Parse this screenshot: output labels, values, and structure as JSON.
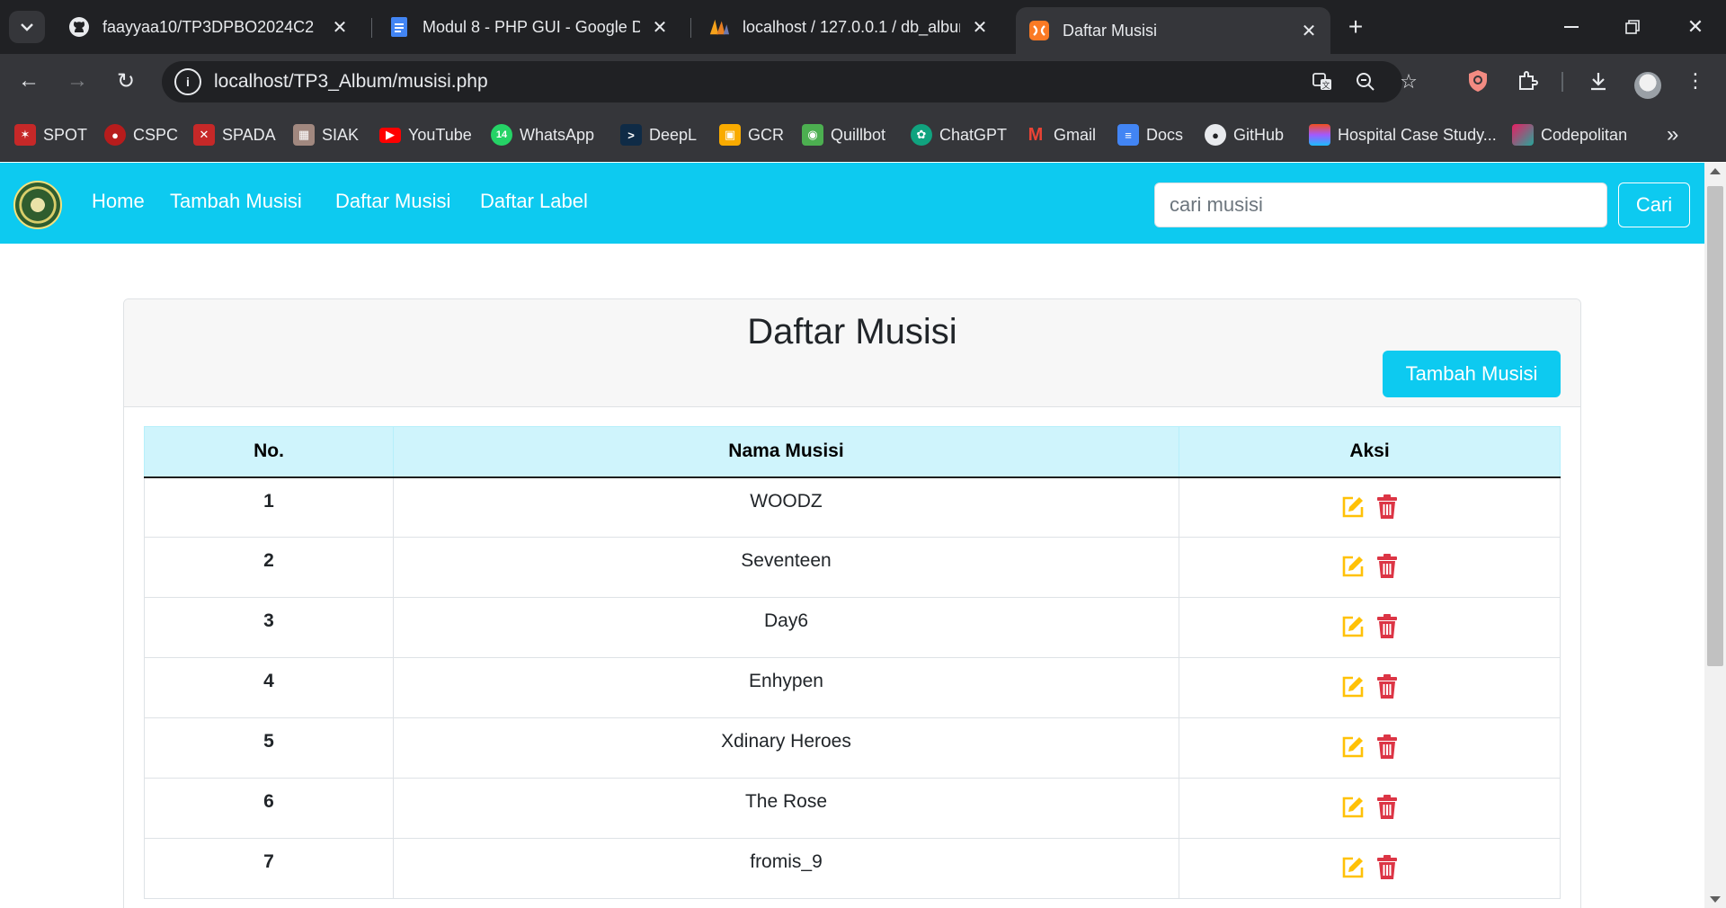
{
  "browser": {
    "tabs": [
      {
        "title": "faayyaa10/TP3DPBO2024C2",
        "icon": "github-icon"
      },
      {
        "title": "Modul 8 - PHP GUI - Google Do",
        "icon": "google-docs-icon"
      },
      {
        "title": "localhost / 127.0.0.1 / db_album",
        "icon": "phpmyadmin-icon"
      },
      {
        "title": "Daftar Musisi",
        "icon": "xampp-icon"
      }
    ],
    "url": "localhost/TP3_Album/musisi.php",
    "bookmarks": [
      {
        "label": "SPOT",
        "color": "#c62828"
      },
      {
        "label": "CSPC",
        "color": "#b71c1c"
      },
      {
        "label": "SPADA",
        "color": "#c62828"
      },
      {
        "label": "SIAK",
        "color": "#a1887f"
      },
      {
        "label": "YouTube",
        "color": "#ff0000"
      },
      {
        "label": "WhatsApp",
        "color": "#25d366"
      },
      {
        "label": "DeepL",
        "color": "#0f2b46"
      },
      {
        "label": "GCR",
        "color": "#f9ab00"
      },
      {
        "label": "Quillbot",
        "color": "#4caf50"
      },
      {
        "label": "ChatGPT",
        "color": "#10a37f"
      },
      {
        "label": "Gmail",
        "color": "#ea4335"
      },
      {
        "label": "Docs",
        "color": "#4285f4"
      },
      {
        "label": "GitHub",
        "color": "#24292e"
      },
      {
        "label": "Hospital Case Study...",
        "color": "#f24e1e"
      },
      {
        "label": "Codepolitan",
        "color": "#e91e63"
      }
    ],
    "whatsapp_badge": "14"
  },
  "navbar": {
    "links": [
      "Home",
      "Tambah Musisi",
      "Daftar Musisi",
      "Daftar Label"
    ],
    "search_placeholder": "cari musisi",
    "search_button": "Cari"
  },
  "card": {
    "title": "Daftar Musisi",
    "add_button": "Tambah Musisi"
  },
  "table": {
    "headers": [
      "No.",
      "Nama Musisi",
      "Aksi"
    ],
    "rows": [
      {
        "no": "1",
        "name": "WOODZ"
      },
      {
        "no": "2",
        "name": "Seventeen"
      },
      {
        "no": "3",
        "name": "Day6"
      },
      {
        "no": "4",
        "name": "Enhypen"
      },
      {
        "no": "5",
        "name": "Xdinary Heroes"
      },
      {
        "no": "6",
        "name": "The Rose"
      },
      {
        "no": "7",
        "name": "fromis_9"
      }
    ]
  },
  "colors": {
    "navbar": "#0dcaf0",
    "table_header": "#cff4fc",
    "edit_icon": "#ffc107",
    "delete_icon": "#dc3545"
  }
}
